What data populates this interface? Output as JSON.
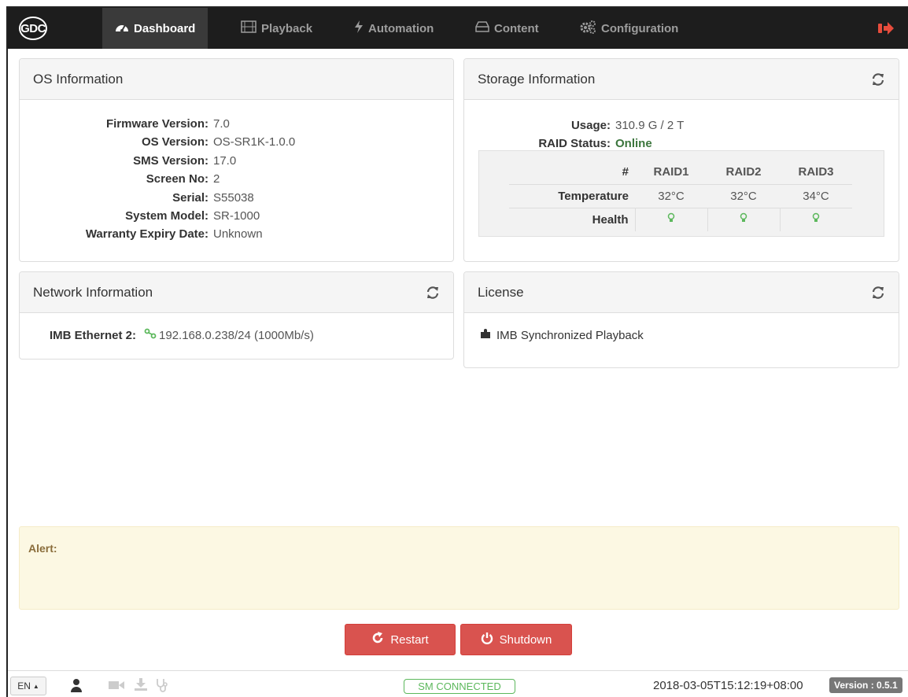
{
  "nav": {
    "logo": "GDC",
    "items": [
      {
        "label": "Dashboard",
        "icon": "dashboard-icon"
      },
      {
        "label": "Playback",
        "icon": "film-icon"
      },
      {
        "label": "Automation",
        "icon": "bolt-icon"
      },
      {
        "label": "Content",
        "icon": "hdd-icon"
      },
      {
        "label": "Configuration",
        "icon": "gears-icon"
      }
    ],
    "active": "Dashboard"
  },
  "os_info": {
    "title": "OS Information",
    "rows": [
      {
        "key": "Firmware Version:",
        "value": "7.0"
      },
      {
        "key": "OS Version:",
        "value": "OS-SR1K-1.0.0"
      },
      {
        "key": "SMS Version:",
        "value": "17.0"
      },
      {
        "key": "Screen No:",
        "value": "2"
      },
      {
        "key": "Serial:",
        "value": "S55038"
      },
      {
        "key": "System Model:",
        "value": "SR-1000"
      },
      {
        "key": "Warranty Expiry Date:",
        "value": "Unknown"
      }
    ]
  },
  "storage": {
    "title": "Storage Information",
    "usage_label": "Usage:",
    "usage_value": "310.9 G / 2 T",
    "raid_label": "RAID Status:",
    "raid_value": "Online",
    "table": {
      "hash": "#",
      "headers": [
        "RAID1",
        "RAID2",
        "RAID3"
      ],
      "temperature_label": "Temperature",
      "temperatures": [
        "32°C",
        "32°C",
        "34°C"
      ],
      "health_label": "Health"
    }
  },
  "network": {
    "title": "Network Information",
    "label": "IMB Ethernet 2:",
    "value": "192.168.0.238/24 (1000Mb/s)"
  },
  "license": {
    "title": "License",
    "item": "IMB Synchronized Playback"
  },
  "alert": {
    "label": "Alert:"
  },
  "buttons": {
    "restart": "Restart",
    "shutdown": "Shutdown"
  },
  "footer": {
    "lang": "EN",
    "status": "SM CONNECTED",
    "datetime": "2018-03-05T15:12:19+08:00",
    "version": "Version : 0.5.1"
  },
  "colors": {
    "navbar": "#1d1d1d",
    "danger": "#d9534f",
    "success": "#5cb85c",
    "alert_bg": "#fcf8e3"
  }
}
